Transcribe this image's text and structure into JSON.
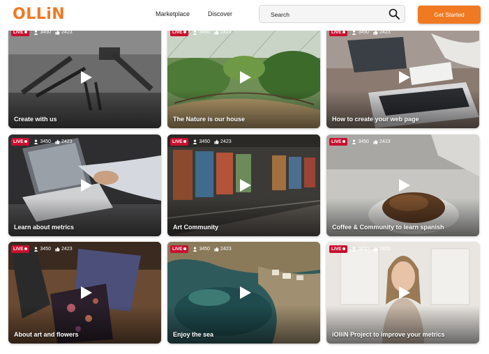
{
  "header": {
    "logo": "OLLiN",
    "nav": [
      "Marketplace",
      "Discover"
    ],
    "search_text": "Search",
    "cta_label": "Get Started"
  },
  "colors": {
    "brand": "#ef7a22",
    "live": "#c8102e"
  },
  "icons": {
    "search": "search-icon",
    "viewers": "user-icon",
    "likes": "thumbs-up-icon",
    "play": "play-icon"
  },
  "cards": [
    {
      "title": "Create with us",
      "live": "LIVE",
      "viewers": "3450",
      "likes": "2423"
    },
    {
      "title": "The Nature is our house",
      "live": "LIVE",
      "viewers": "3450",
      "likes": "2423"
    },
    {
      "title": "How to create your web page",
      "live": "LIVE",
      "viewers": "3450",
      "likes": "2423"
    },
    {
      "title": "Learn about metrics",
      "live": "LIVE",
      "viewers": "3450",
      "likes": "2423"
    },
    {
      "title": "Art Community",
      "live": "LIVE",
      "viewers": "3450",
      "likes": "2423"
    },
    {
      "title": "Coffee & Community to learn spanish",
      "live": "LIVE",
      "viewers": "3450",
      "likes": "2423"
    },
    {
      "title": "About art and flowers",
      "live": "LIVE",
      "viewers": "3450",
      "likes": "2423"
    },
    {
      "title": "Enjoy the sea",
      "live": "LIVE",
      "viewers": "3450",
      "likes": "2423"
    },
    {
      "title": "iOlliN Project to improve your metrics",
      "live": "LIVE",
      "viewers": "3450",
      "likes": "2423"
    }
  ]
}
